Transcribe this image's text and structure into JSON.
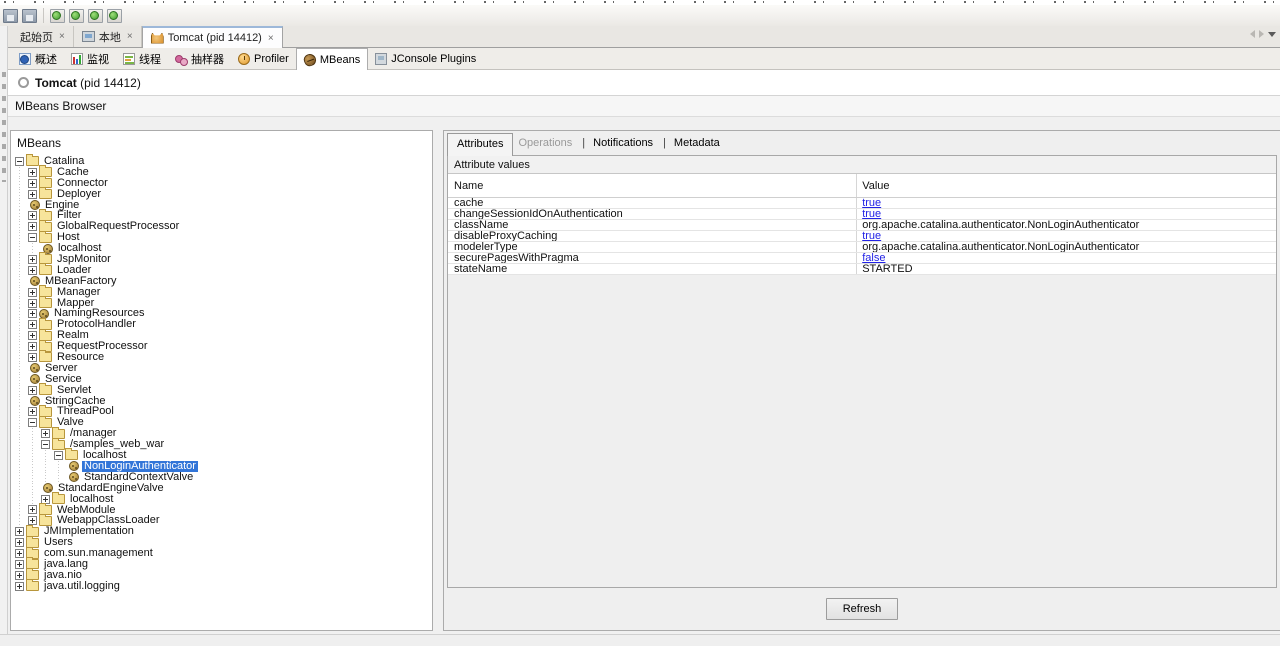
{
  "colors": {
    "selection": "#3275d8",
    "editable_value_link": "#2222e6",
    "folder_icon": "#f7e49b",
    "bean_icon": "#c8a648",
    "panel_bg": "#f0f0f0"
  },
  "toolbar": {
    "icons": [
      {
        "name": "save-icon",
        "type": "disk"
      },
      {
        "name": "save-all-icon",
        "type": "disk"
      },
      {
        "name": "snapshot-icon-1",
        "type": "green"
      },
      {
        "name": "snapshot-icon-2",
        "type": "green"
      },
      {
        "name": "snapshot-icon-3",
        "type": "green"
      },
      {
        "name": "snapshot-icon-4",
        "type": "green"
      }
    ]
  },
  "document_tabs": [
    {
      "label": "起始页",
      "icon": "none",
      "active": false
    },
    {
      "label": "本地",
      "icon": "computer-icon",
      "active": false
    },
    {
      "label": "Tomcat (pid 14412)",
      "icon": "tomcat-icon",
      "active": true
    }
  ],
  "tab_close_glyph": "×",
  "subtabs": [
    {
      "label": "概述",
      "icon": "overview-icon",
      "active": false
    },
    {
      "label": "监视",
      "icon": "monitor-icon",
      "active": false
    },
    {
      "label": "线程",
      "icon": "threads-icon",
      "active": false
    },
    {
      "label": "抽样器",
      "icon": "sampler-icon",
      "active": false
    },
    {
      "label": "Profiler",
      "icon": "profiler-icon",
      "active": false
    },
    {
      "label": "MBeans",
      "icon": "bean-icon",
      "active": true
    },
    {
      "label": "JConsole Plugins",
      "icon": "plugin-icon",
      "active": false
    }
  ],
  "header": {
    "app_label_bold": "Tomcat",
    "app_label_rest": " (pid 14412)"
  },
  "section_title": "MBeans Browser",
  "tree": {
    "title": "MBeans",
    "items": [
      {
        "label": "Catalina",
        "depth": 0,
        "expander": "minus",
        "icon": "folder"
      },
      {
        "label": "Cache",
        "depth": 1,
        "expander": "plus",
        "icon": "folder"
      },
      {
        "label": "Connector",
        "depth": 1,
        "expander": "plus",
        "icon": "folder"
      },
      {
        "label": "Deployer",
        "depth": 1,
        "expander": "plus",
        "icon": "folder"
      },
      {
        "label": "Engine",
        "depth": 1,
        "expander": "none",
        "icon": "bean"
      },
      {
        "label": "Filter",
        "depth": 1,
        "expander": "plus",
        "icon": "folder"
      },
      {
        "label": "GlobalRequestProcessor",
        "depth": 1,
        "expander": "plus",
        "icon": "folder"
      },
      {
        "label": "Host",
        "depth": 1,
        "expander": "minus",
        "icon": "folder"
      },
      {
        "label": "localhost",
        "depth": 2,
        "expander": "none",
        "icon": "bean"
      },
      {
        "label": "JspMonitor",
        "depth": 1,
        "expander": "plus",
        "icon": "folder"
      },
      {
        "label": "Loader",
        "depth": 1,
        "expander": "plus",
        "icon": "folder"
      },
      {
        "label": "MBeanFactory",
        "depth": 1,
        "expander": "none",
        "icon": "bean"
      },
      {
        "label": "Manager",
        "depth": 1,
        "expander": "plus",
        "icon": "folder"
      },
      {
        "label": "Mapper",
        "depth": 1,
        "expander": "plus",
        "icon": "folder"
      },
      {
        "label": "NamingResources",
        "depth": 1,
        "expander": "plus",
        "icon": "bean"
      },
      {
        "label": "ProtocolHandler",
        "depth": 1,
        "expander": "plus",
        "icon": "folder"
      },
      {
        "label": "Realm",
        "depth": 1,
        "expander": "plus",
        "icon": "folder"
      },
      {
        "label": "RequestProcessor",
        "depth": 1,
        "expander": "plus",
        "icon": "folder"
      },
      {
        "label": "Resource",
        "depth": 1,
        "expander": "plus",
        "icon": "folder"
      },
      {
        "label": "Server",
        "depth": 1,
        "expander": "none",
        "icon": "bean"
      },
      {
        "label": "Service",
        "depth": 1,
        "expander": "none",
        "icon": "bean"
      },
      {
        "label": "Servlet",
        "depth": 1,
        "expander": "plus",
        "icon": "folder"
      },
      {
        "label": "StringCache",
        "depth": 1,
        "expander": "none",
        "icon": "bean"
      },
      {
        "label": "ThreadPool",
        "depth": 1,
        "expander": "plus",
        "icon": "folder"
      },
      {
        "label": "Valve",
        "depth": 1,
        "expander": "minus",
        "icon": "folder"
      },
      {
        "label": "/manager",
        "depth": 2,
        "expander": "plus",
        "icon": "folder"
      },
      {
        "label": "/samples_web_war",
        "depth": 2,
        "expander": "minus",
        "icon": "folder"
      },
      {
        "label": "localhost",
        "depth": 3,
        "expander": "minus",
        "icon": "folder"
      },
      {
        "label": "NonLoginAuthenticator",
        "depth": 4,
        "expander": "none",
        "icon": "bean",
        "selected": true
      },
      {
        "label": "StandardContextValve",
        "depth": 4,
        "expander": "none",
        "icon": "bean"
      },
      {
        "label": "StandardEngineValve",
        "depth": 2,
        "expander": "none",
        "icon": "bean"
      },
      {
        "label": "localhost",
        "depth": 2,
        "expander": "plus",
        "icon": "folder"
      },
      {
        "label": "WebModule",
        "depth": 1,
        "expander": "plus",
        "icon": "folder"
      },
      {
        "label": "WebappClassLoader",
        "depth": 1,
        "expander": "plus",
        "icon": "folder"
      },
      {
        "label": "JMImplementation",
        "depth": 0,
        "expander": "plus",
        "icon": "folder"
      },
      {
        "label": "Users",
        "depth": 0,
        "expander": "plus",
        "icon": "folder"
      },
      {
        "label": "com.sun.management",
        "depth": 0,
        "expander": "plus",
        "icon": "folder"
      },
      {
        "label": "java.lang",
        "depth": 0,
        "expander": "plus",
        "icon": "folder"
      },
      {
        "label": "java.nio",
        "depth": 0,
        "expander": "plus",
        "icon": "folder"
      },
      {
        "label": "java.util.logging",
        "depth": 0,
        "expander": "plus",
        "icon": "folder"
      }
    ]
  },
  "attributes": {
    "tabs": [
      {
        "label": "Attributes",
        "state": "selected"
      },
      {
        "label": "Operations",
        "state": "disabled"
      },
      {
        "label": "Notifications",
        "state": "normal"
      },
      {
        "label": "Metadata",
        "state": "normal"
      }
    ],
    "section_label": "Attribute values",
    "columns": [
      "Name",
      "Value"
    ],
    "rows": [
      {
        "name": "cache",
        "value": "true",
        "style": "link"
      },
      {
        "name": "changeSessionIdOnAuthentication",
        "value": "true",
        "style": "link"
      },
      {
        "name": "className",
        "value": "org.apache.catalina.authenticator.NonLoginAuthenticator",
        "style": "plain"
      },
      {
        "name": "disableProxyCaching",
        "value": "true",
        "style": "link"
      },
      {
        "name": "modelerType",
        "value": "org.apache.catalina.authenticator.NonLoginAuthenticator",
        "style": "plain"
      },
      {
        "name": "securePagesWithPragma",
        "value": "false",
        "style": "link"
      },
      {
        "name": "stateName",
        "value": "STARTED",
        "style": "plain"
      }
    ],
    "refresh_label": "Refresh"
  }
}
